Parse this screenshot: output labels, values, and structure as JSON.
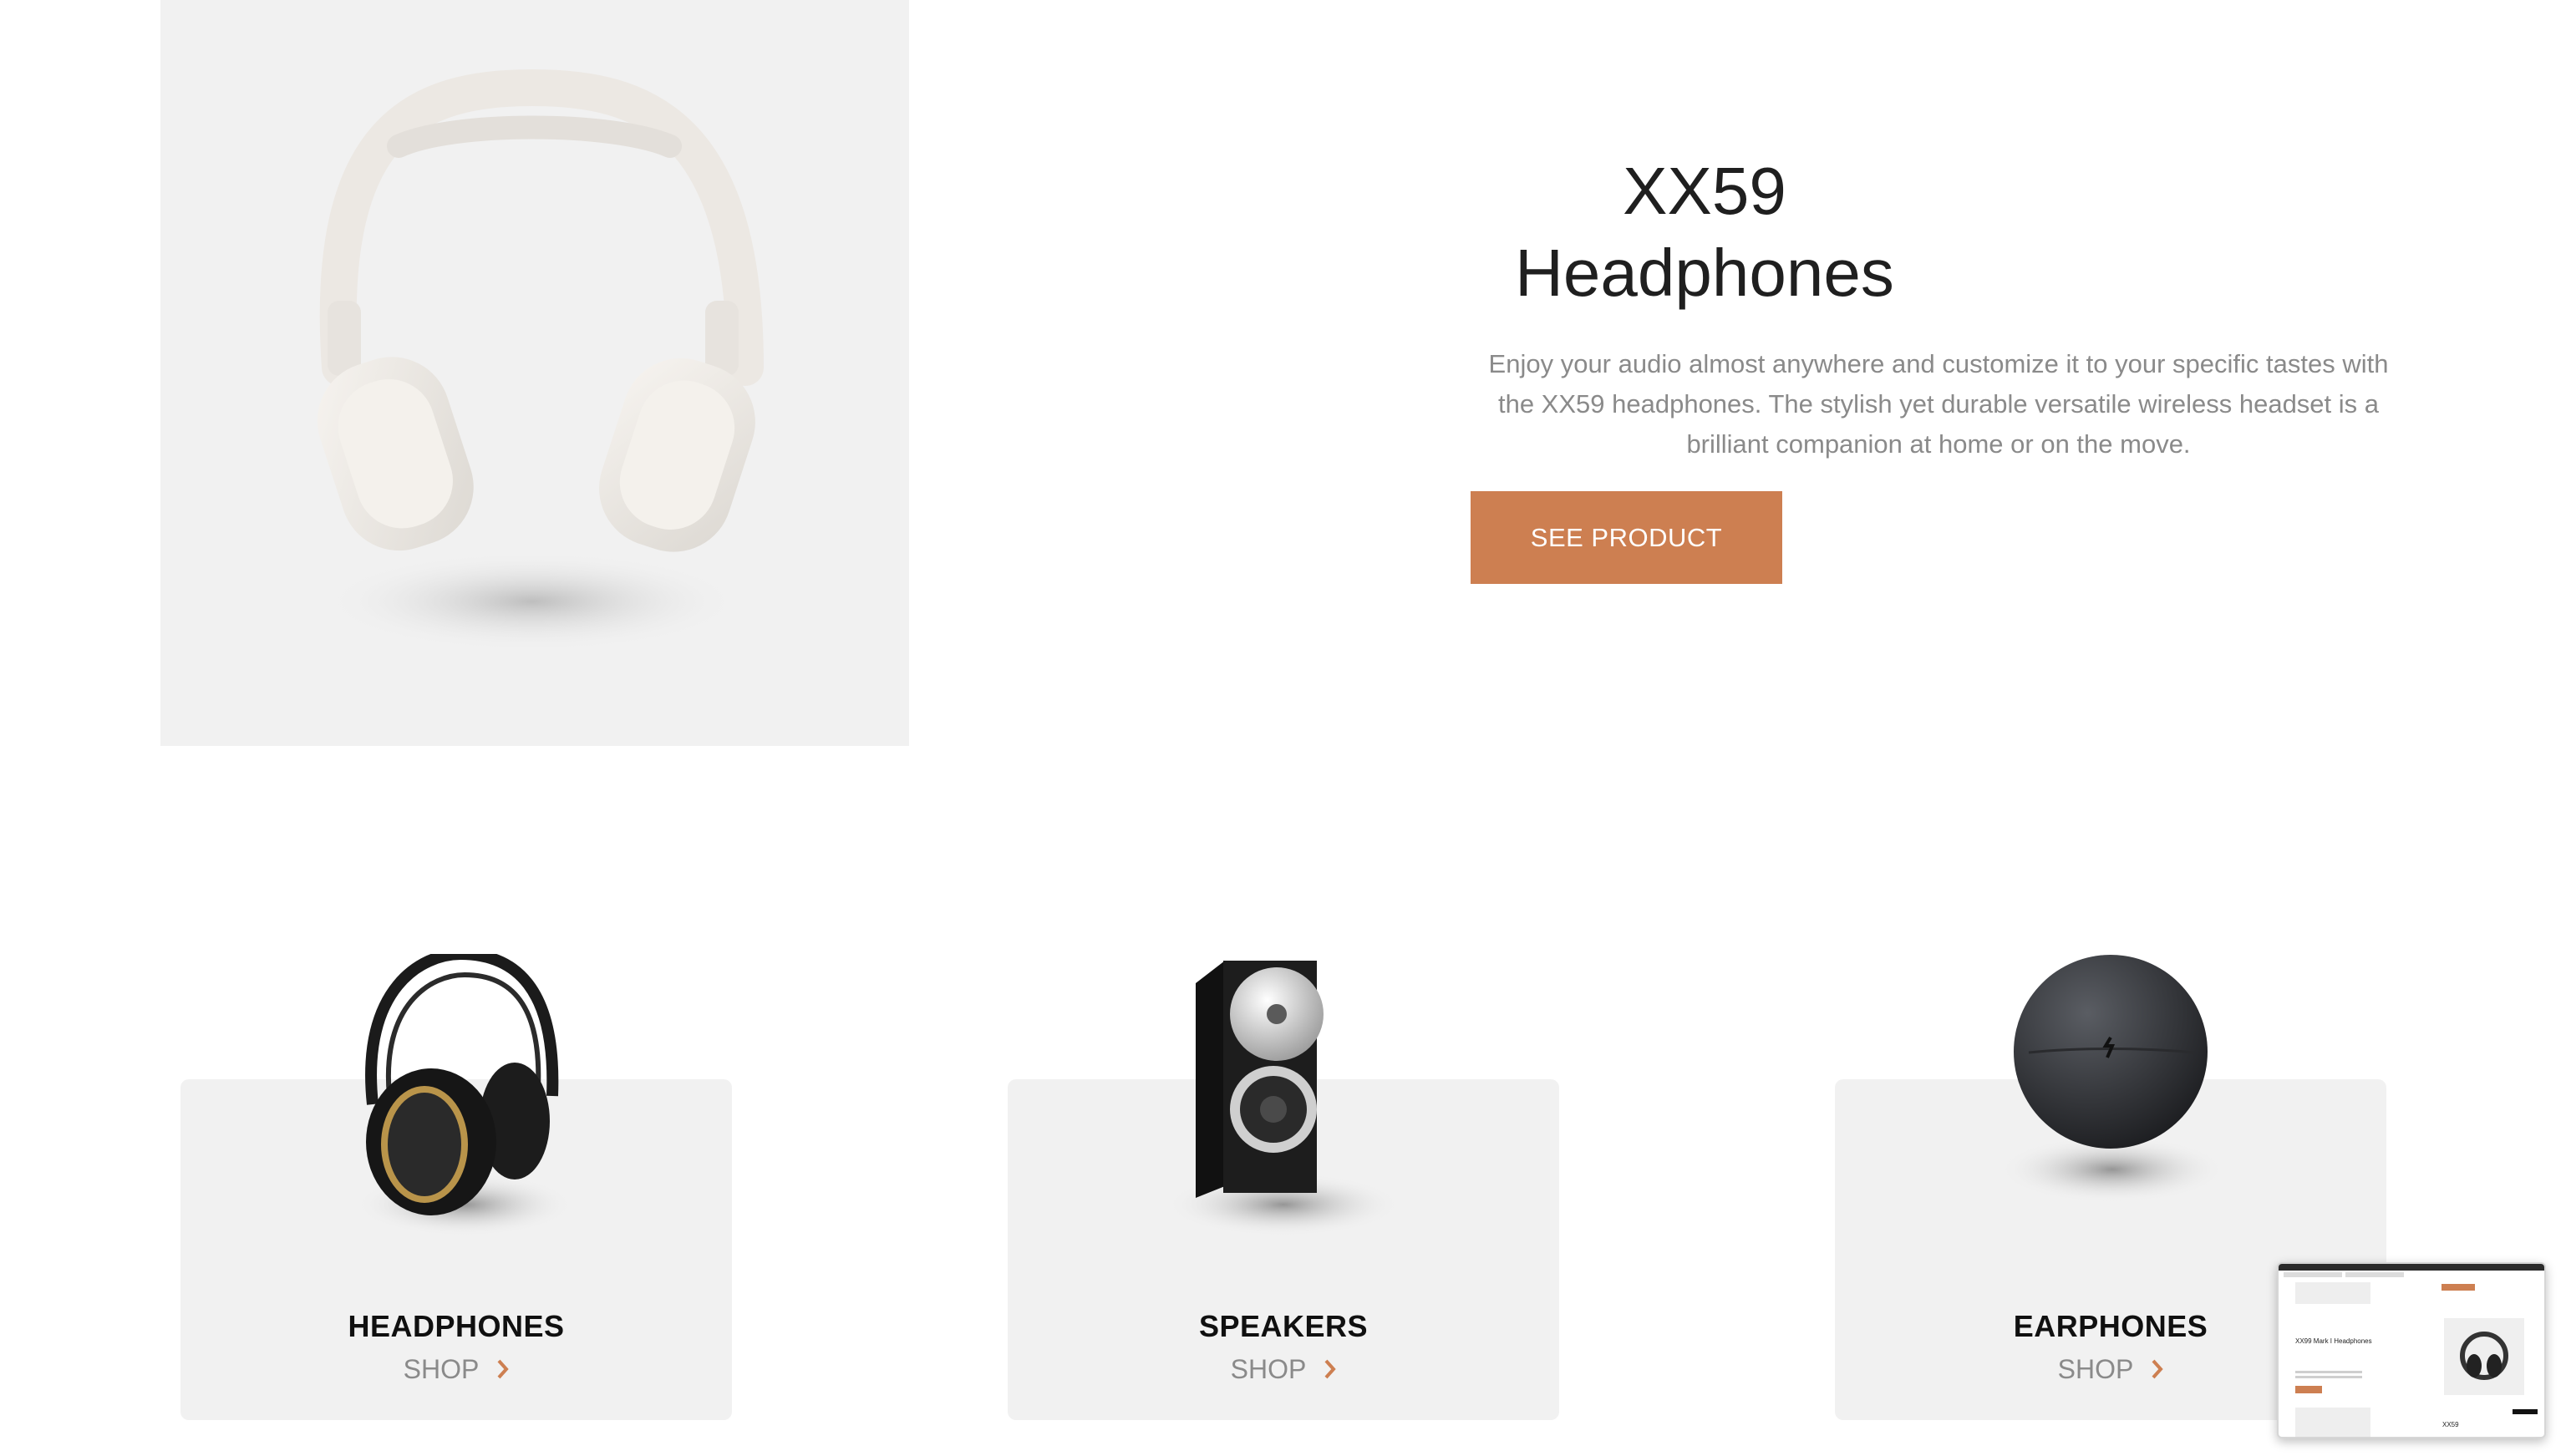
{
  "hero": {
    "title_line1": "XX59",
    "title_line2": "Headphones",
    "description": "Enjoy your audio almost anywhere and customize it to your specific tastes with the XX59 headphones. The stylish yet durable versatile wireless headset is a brilliant companion at home or on the move.",
    "cta_label": "SEE PRODUCT",
    "image_icon": "white-headphones-image"
  },
  "categories": [
    {
      "name": "HEADPHONES",
      "shop_label": "SHOP",
      "image_icon": "black-headphones-image"
    },
    {
      "name": "SPEAKERS",
      "shop_label": "SHOP",
      "image_icon": "speaker-image"
    },
    {
      "name": "EARPHONES",
      "shop_label": "SHOP",
      "image_icon": "earphones-case-image"
    }
  ],
  "preview": {
    "title": "XX99 Mark I Headphones",
    "footer": "XX59"
  },
  "colors": {
    "accent": "#cd7f51",
    "card_bg": "#f1f1f1",
    "text_dark": "#1f1f1f",
    "text_muted": "#8a8a8a"
  }
}
